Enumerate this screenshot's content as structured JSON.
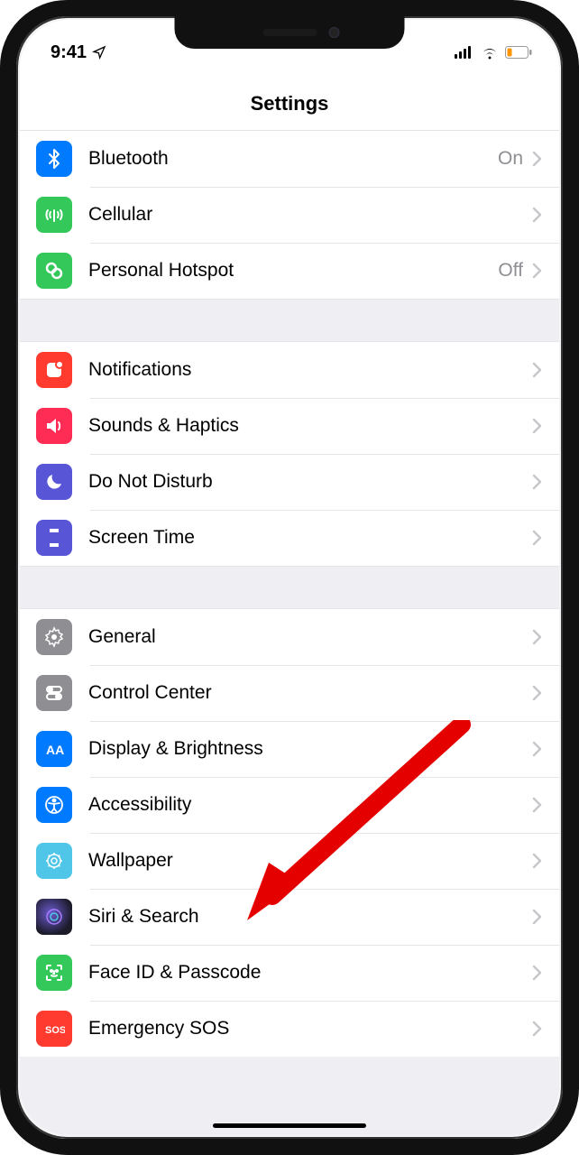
{
  "statusbar": {
    "time": "9:41"
  },
  "header": {
    "title": "Settings"
  },
  "groups": [
    {
      "items": [
        {
          "key": "bluetooth",
          "label": "Bluetooth",
          "status": "On",
          "icon": "bluetooth-icon",
          "bg": "#007aff"
        },
        {
          "key": "cellular",
          "label": "Cellular",
          "icon": "cellular-icon",
          "bg": "#34c759"
        },
        {
          "key": "hotspot",
          "label": "Personal Hotspot",
          "status": "Off",
          "icon": "hotspot-icon",
          "bg": "#34c759"
        }
      ]
    },
    {
      "items": [
        {
          "key": "notifications",
          "label": "Notifications",
          "icon": "notifications-icon",
          "bg": "#ff3b30"
        },
        {
          "key": "sounds",
          "label": "Sounds & Haptics",
          "icon": "sounds-icon",
          "bg": "#ff2d55"
        },
        {
          "key": "dnd",
          "label": "Do Not Disturb",
          "icon": "dnd-icon",
          "bg": "#5856d6"
        },
        {
          "key": "screentime",
          "label": "Screen Time",
          "icon": "screentime-icon",
          "bg": "#5856d6"
        }
      ]
    },
    {
      "items": [
        {
          "key": "general",
          "label": "General",
          "icon": "general-icon",
          "bg": "#8e8e93"
        },
        {
          "key": "controlcenter",
          "label": "Control Center",
          "icon": "controlcenter-icon",
          "bg": "#8e8e93"
        },
        {
          "key": "display",
          "label": "Display & Brightness",
          "icon": "display-icon",
          "bg": "#007aff"
        },
        {
          "key": "accessibility",
          "label": "Accessibility",
          "icon": "accessibility-icon",
          "bg": "#007aff"
        },
        {
          "key": "wallpaper",
          "label": "Wallpaper",
          "icon": "wallpaper-icon",
          "bg": "#4fc5e8"
        },
        {
          "key": "siri",
          "label": "Siri & Search",
          "icon": "siri-icon",
          "bg": "#1b1b2a"
        },
        {
          "key": "faceid",
          "label": "Face ID & Passcode",
          "icon": "faceid-icon",
          "bg": "#34c759"
        },
        {
          "key": "emergency",
          "label": "Emergency SOS",
          "icon": "emergency-icon",
          "bg": "#ff3b30"
        }
      ]
    }
  ],
  "annotation": {
    "target": "accessibility"
  }
}
